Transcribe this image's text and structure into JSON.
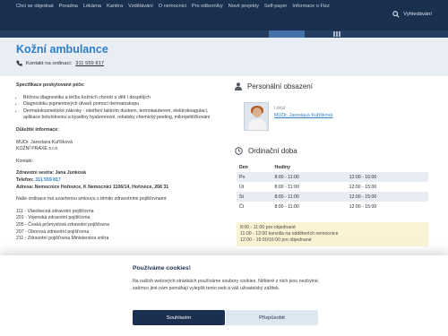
{
  "nav": {
    "items": [
      "Chci se objednat",
      "Poradna",
      "Lékárna",
      "Kariéra",
      "Vzdělávání",
      "O nemocnici",
      "Pro odborníky",
      "Nové projekty",
      "Self-payer",
      "Informace o Fizz"
    ],
    "search_label": "Vyhledávání"
  },
  "header": {
    "title": "Kožní ambulance",
    "contact_label": "Kontakt na ordinaci:",
    "contact_phone": "311 559 817"
  },
  "content": {
    "services_heading": "Specifikace poskytované péče:",
    "services": [
      "Běžnou diagnostiku a léčbu kožních chorob u dětí i dospělých",
      "Diagnostiku pigmentových útvarů pomocí dermatoskopu",
      "Dermatokosmetické zákroky - ošetření taktním duskem, termokauterem, elektrokoagulací, aplikace botulotoxinu a kyseliny hyaluronové, rekatsky chemický peeling, mikrojehličkování"
    ],
    "important_heading": "Důležité informace:",
    "doctor_line": "MUDr. Jaroslava Kuříšková",
    "company_line": "KOŽNÍ PRAXE s.r.o.",
    "contact_word": "Kontakt:",
    "nurse_line": "Zdravotní sestra: Jana Junková",
    "phone_label": "Telefon:",
    "phone_value": "311 559 817",
    "address_line": "Adresa: Nemocnice Hořovice, K Nemocnici 1106/14, Hořovice, 268 31",
    "contract_line": "Naše ordinace má uzavřenou smlouvu s těmito zdravotními pojišťovnami:",
    "insurers": [
      "111 - Všeobecná zdravotní pojišťovna",
      "201 - Vojenská zdravotní pojišťovna",
      "205 - Česká průmyslová zdravotní pojišťovna",
      "207 - Oborová zdravotní pojišťovna",
      "211 - Zdravotní pojišťovna Ministerstva vnitra"
    ]
  },
  "staff": {
    "title": "Personální obsazení",
    "role": "Lékař",
    "name": "MUDr. Jaroslava Kuříšková"
  },
  "hours": {
    "title": "Ordinační doba",
    "col_day": "Den",
    "col_hours": "Hodiny",
    "rows": [
      {
        "day": "Po",
        "am": "8:00 - 11:00",
        "pm": "12:00 - 16:00"
      },
      {
        "day": "Út",
        "am": "8:00 - 11:00",
        "pm": "12:00 - 15:00"
      },
      {
        "day": "St",
        "am": "8:00 - 11:00",
        "pm": "12:00 - 15:00"
      },
      {
        "day": "Čt",
        "am": "8:00 - 11:00",
        "pm": "12:00 - 15:00"
      }
    ],
    "notes": [
      "8:00 - 11:00 pro objednané",
      "11:00 - 12:00 konzilia na odděleních nemocnice",
      "12:00 - 15:00/16:00 pro objednané"
    ]
  },
  "cookie": {
    "title": "Používáme cookies!",
    "text": "Na našich webových stránkách používáme soubory cookies. Některé z nich jsou nezbytné, zatímco jiné nám pomáhají vylepšit tento web a váš uživatelský zážitek.",
    "accept_label": "Souhlasím",
    "customize_label": "Přizpůsobit"
  },
  "colors": {
    "navy": "#1b2f4f",
    "accent_blue": "#2f7ec7",
    "hero_bg": "#e9eef5",
    "note_bg": "#fbf2d4"
  }
}
